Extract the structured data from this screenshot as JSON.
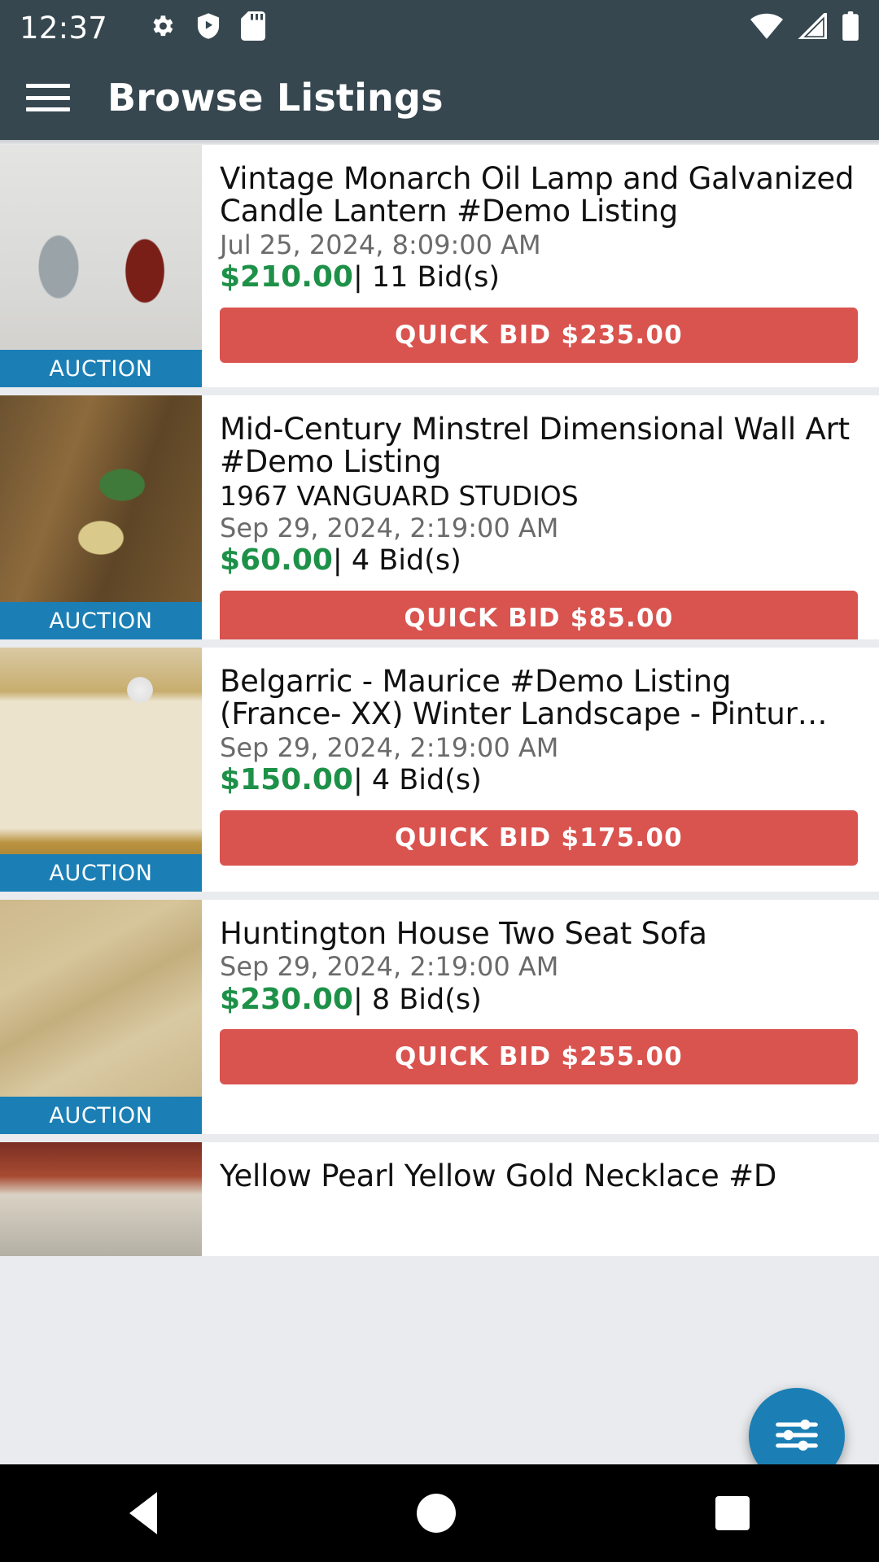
{
  "statusbar": {
    "time": "12:37",
    "left_icons": [
      "gear-icon",
      "shield-play-icon",
      "sd-card-icon"
    ],
    "right_icons": [
      "wifi-icon",
      "cellular-signal-icon",
      "battery-icon"
    ]
  },
  "appbar": {
    "menu_icon": "hamburger-menu-icon",
    "title": "Browse Listings",
    "background": "#37474f"
  },
  "colors": {
    "accent_blue": "#1b7fb5",
    "bid_red": "#d9534f",
    "price_green": "#1e9148",
    "appbar": "#37474f"
  },
  "listings": [
    {
      "title": "Vintage Monarch Oil Lamp and Galvanized Candle Lantern #Demo Listing",
      "subtitle": "",
      "date": "Jul 25, 2024, 8:09:00 AM",
      "price": "$210.00",
      "bids": "| 11 Bid(s)",
      "bid_button": "QUICK BID $235.00",
      "badge": "AUCTION",
      "thumb_class": "t1"
    },
    {
      "title": "Mid-Century Minstrel Dimensional Wall Art #Demo Listing",
      "subtitle": "1967 VANGUARD STUDIOS",
      "date": "Sep 29, 2024, 2:19:00 AM",
      "price": "$60.00",
      "bids": "| 4 Bid(s)",
      "bid_button": "QUICK BID $85.00",
      "badge": "AUCTION",
      "thumb_class": "t2"
    },
    {
      "title": "Belgarric - Maurice #Demo Listing (France- XX) Winter Landscape - Pintur…",
      "subtitle": "",
      "date": "Sep 29, 2024, 2:19:00 AM",
      "price": "$150.00",
      "bids": "| 4 Bid(s)",
      "bid_button": "QUICK BID $175.00",
      "badge": "AUCTION",
      "thumb_class": "t3"
    },
    {
      "title": "Huntington House Two Seat Sofa",
      "subtitle": "",
      "date": "Sep 29, 2024, 2:19:00 AM",
      "price": "$230.00",
      "bids": "| 8 Bid(s)",
      "bid_button": "QUICK BID $255.00",
      "badge": "AUCTION",
      "thumb_class": "t4"
    },
    {
      "title": "Yellow Pearl Yellow Gold Necklace #D",
      "subtitle": "",
      "date": "",
      "price": "",
      "bids": "",
      "bid_button": "",
      "badge": "",
      "thumb_class": "t5"
    }
  ],
  "fab": {
    "icon": "filter-sliders-icon",
    "color": "#1b7fb5"
  },
  "navbar": {
    "back": "back-nav-icon",
    "home": "home-nav-icon",
    "recent": "recent-apps-nav-icon"
  }
}
